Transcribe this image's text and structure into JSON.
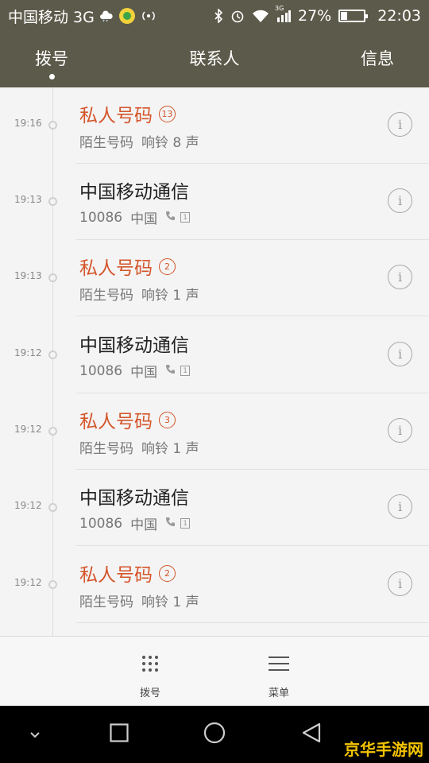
{
  "status_bar": {
    "carrier": "中国移动 3G",
    "network_small": "3G",
    "battery_pct": "27%",
    "time": "22:03",
    "icons": [
      "cloud-weather-icon",
      "app-notification-icon",
      "hotspot-icon",
      "bluetooth-icon",
      "alarm-icon",
      "wifi-icon",
      "signal-icon",
      "battery-icon"
    ]
  },
  "tabs": [
    {
      "label": "拨号",
      "active": true
    },
    {
      "label": "联系人",
      "active": false
    },
    {
      "label": "信息",
      "active": false
    }
  ],
  "calls": [
    {
      "time": "19:16",
      "name": "私人号码",
      "count": "13",
      "missed": true,
      "sub1": "陌生号码",
      "sub2": "响铃 8 声"
    },
    {
      "time": "19:13",
      "name": "中国移动通信",
      "count": "",
      "missed": false,
      "sub1": "10086",
      "sub2": "中国",
      "sim": "1"
    },
    {
      "time": "19:13",
      "name": "私人号码",
      "count": "2",
      "missed": true,
      "sub1": "陌生号码",
      "sub2": "响铃 1 声"
    },
    {
      "time": "19:12",
      "name": "中国移动通信",
      "count": "",
      "missed": false,
      "sub1": "10086",
      "sub2": "中国",
      "sim": "1"
    },
    {
      "time": "19:12",
      "name": "私人号码",
      "count": "3",
      "missed": true,
      "sub1": "陌生号码",
      "sub2": "响铃 1 声"
    },
    {
      "time": "19:12",
      "name": "中国移动通信",
      "count": "",
      "missed": false,
      "sub1": "10086",
      "sub2": "中国",
      "sim": "1"
    },
    {
      "time": "19:12",
      "name": "私人号码",
      "count": "2",
      "missed": true,
      "sub1": "陌生号码",
      "sub2": "响铃 1 声"
    }
  ],
  "info_icon": "i",
  "actions": {
    "dial_label": "拨号",
    "menu_label": "菜单"
  },
  "watermark": "京华手游网",
  "colors": {
    "header_bg": "#5c5a4a",
    "missed_accent": "#d4552a",
    "watermark": "#f3c300"
  }
}
